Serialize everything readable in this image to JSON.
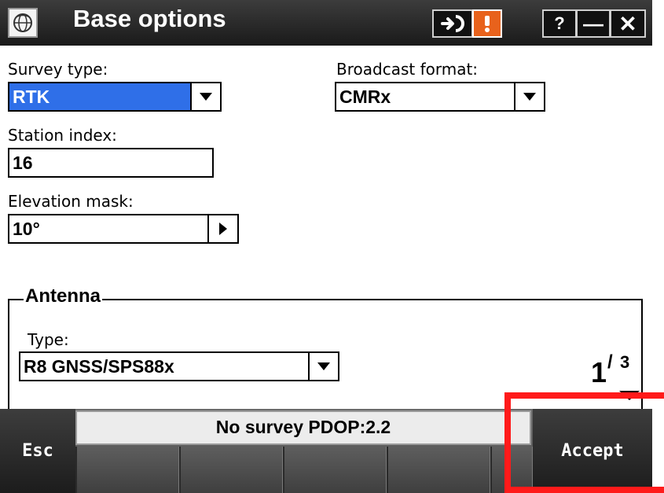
{
  "window": {
    "title": "Base options",
    "help_label": "?",
    "minimize_label": "—",
    "close_label": "✕"
  },
  "form": {
    "survey_type": {
      "label": "Survey type:",
      "value": "RTK"
    },
    "broadcast_format": {
      "label": "Broadcast format:",
      "value": "CMRx"
    },
    "station_index": {
      "label": "Station index:",
      "value": "16"
    },
    "elevation_mask": {
      "label": "Elevation mask:",
      "value": "10°"
    }
  },
  "antenna": {
    "group_title": "Antenna",
    "type_label": "Type:",
    "type_value": "R8 GNSS/SPS88x"
  },
  "pagination": {
    "current": "1",
    "total": "3"
  },
  "status": {
    "text": "No survey  PDOP:2.2"
  },
  "footer": {
    "esc_label": "Esc",
    "accept_label": "Accept"
  },
  "colors": {
    "selection": "#2f6fe8",
    "alert": "#e8621c",
    "highlight": "#ff1a1a"
  }
}
